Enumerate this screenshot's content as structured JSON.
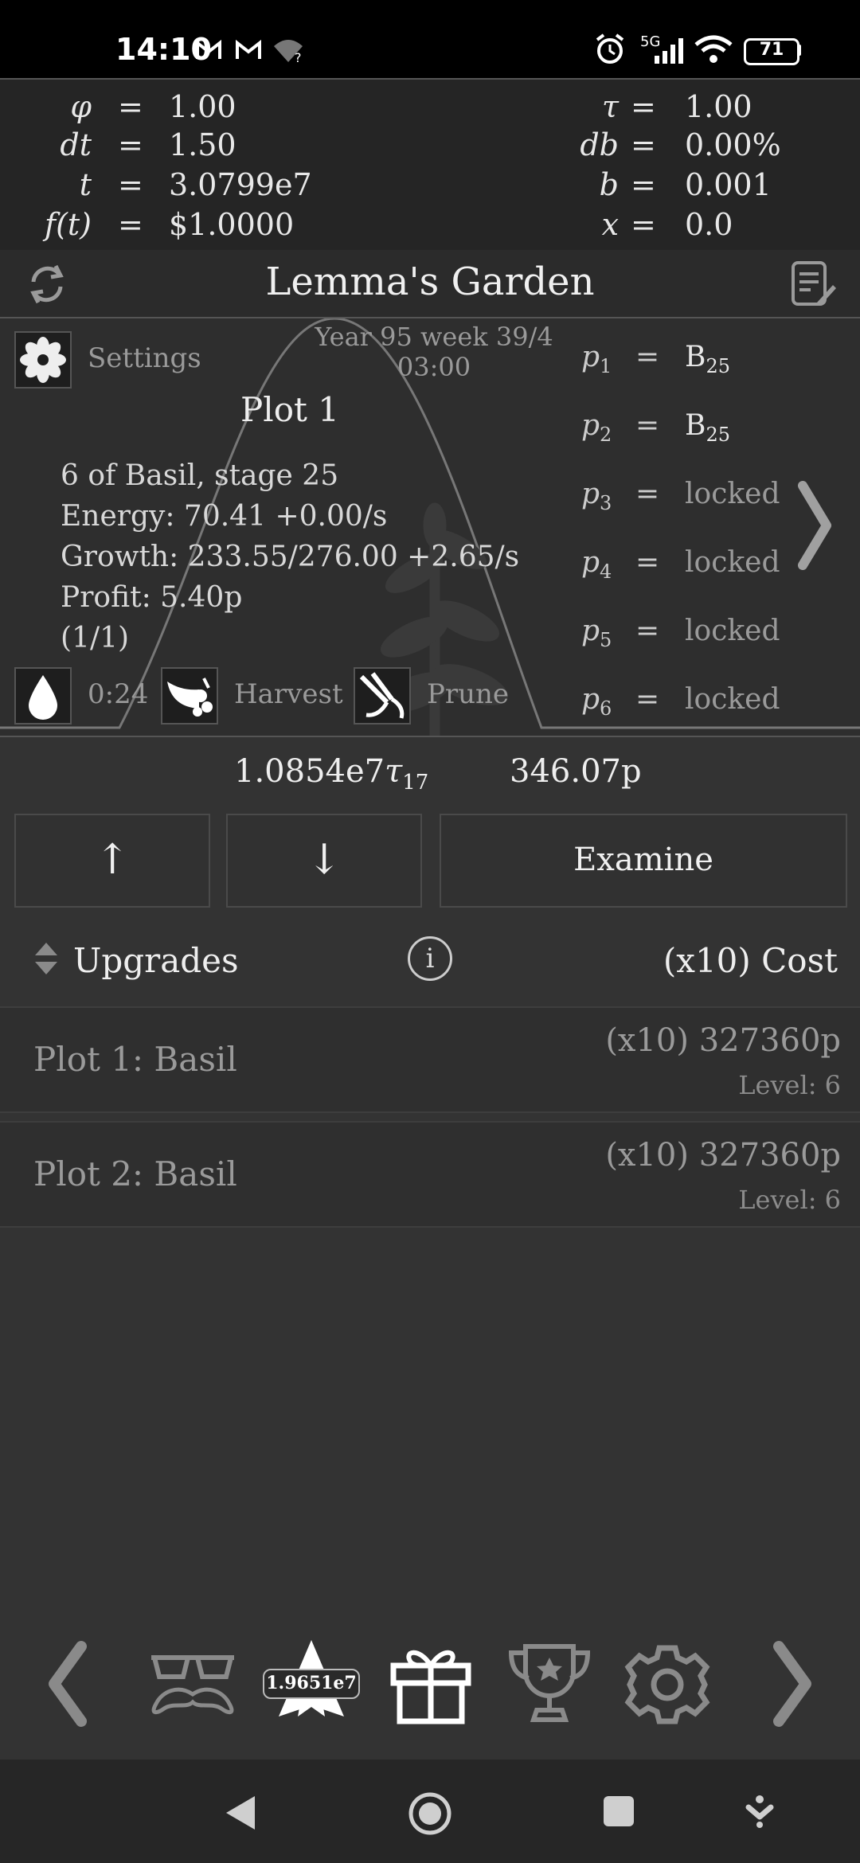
{
  "status_bar": {
    "time": "14:10",
    "network": "5G",
    "battery": "71",
    "icons": [
      "gmail-icon",
      "gmail-icon",
      "wifi-question-icon",
      "alarm-icon",
      "signal-icon",
      "wifi-icon",
      "battery-icon"
    ]
  },
  "equations": {
    "left": [
      {
        "name": "φ",
        "eq": "=",
        "value": "1.00"
      },
      {
        "name": "dt",
        "eq": "=",
        "value": "1.50"
      },
      {
        "name": "t",
        "eq": "=",
        "value": "3.0799e7"
      },
      {
        "name": "f(t)",
        "eq": "=",
        "value": "$1.0000"
      }
    ],
    "right": [
      {
        "name": "τ",
        "eq": "=",
        "value": "1.00"
      },
      {
        "name": "db",
        "eq": "=",
        "value": "0.00%"
      },
      {
        "name": "b",
        "eq": "=",
        "value": "0.001"
      },
      {
        "name": "x",
        "eq": "=",
        "value": "0.0"
      }
    ]
  },
  "header": {
    "title": "Lemma's Garden",
    "left_icon": "swap-icon",
    "right_icon": "notes-icon"
  },
  "garden": {
    "settings_label": "Settings",
    "date_line1": "Year 95 week 39/4",
    "date_line2": "03:00",
    "plot_title": "Plot 1",
    "info": [
      "6 of Basil, stage 25",
      "Energy:  70.41  +0.00/s",
      "Growth:  233.55/276.00  +2.65/s",
      "Profit:  5.40p",
      "(1/1)"
    ],
    "water_timer": "0:24",
    "harvest_label": "Harvest",
    "prune_label": "Prune",
    "plots": [
      {
        "name": "p",
        "sub": "1",
        "eq": "=",
        "value": "B",
        "value_sub": "25"
      },
      {
        "name": "p",
        "sub": "2",
        "eq": "=",
        "value": "B",
        "value_sub": "25"
      },
      {
        "name": "p",
        "sub": "3",
        "eq": "=",
        "value": "locked",
        "value_sub": ""
      },
      {
        "name": "p",
        "sub": "4",
        "eq": "=",
        "value": "locked",
        "value_sub": ""
      },
      {
        "name": "p",
        "sub": "5",
        "eq": "=",
        "value": "locked",
        "value_sub": ""
      },
      {
        "name": "p",
        "sub": "6",
        "eq": "=",
        "value": "locked",
        "value_sub": ""
      }
    ],
    "next_arrow": "❯"
  },
  "currency": {
    "tau_value": "1.0854e7",
    "tau_symbol": "τ",
    "tau_sub": "17",
    "p_value": "346.07p"
  },
  "buttons": {
    "up": "↑",
    "down": "↓",
    "examine": "Examine"
  },
  "upgrades": {
    "header_label": "Upgrades",
    "info_icon": "i",
    "cost_label": "(x10)  Cost",
    "items": [
      {
        "label": "Plot 1: Basil",
        "cost": "(x10)  327360p",
        "level": "Level: 6"
      },
      {
        "label": "Plot 2: Basil",
        "cost": "(x10)  327360p",
        "level": "Level: 6"
      }
    ]
  },
  "toolbar": {
    "star_value": "1.9651e7",
    "icons": [
      "chevron-left-icon",
      "glasses-mustache-icon",
      "star-icon",
      "gift-icon",
      "trophy-icon",
      "gear-icon",
      "chevron-right-icon"
    ]
  },
  "colors": {
    "background": "#333333",
    "panel": "#252525",
    "text": "#e8e8e8",
    "muted": "#9a9a9a"
  }
}
